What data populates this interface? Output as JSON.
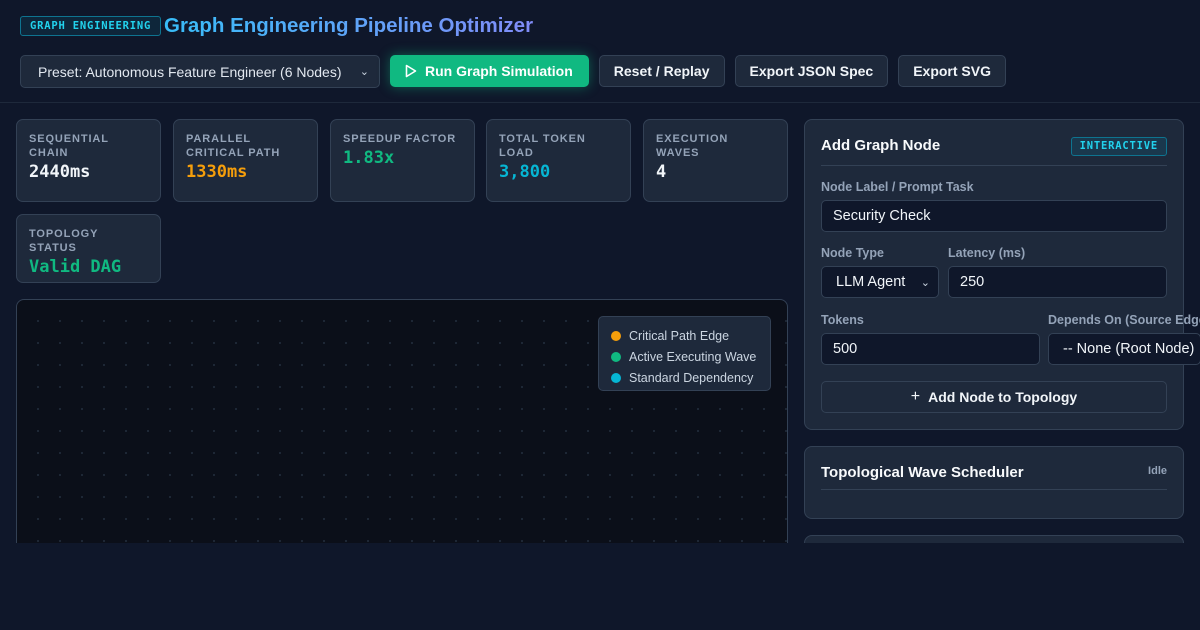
{
  "header": {
    "badge": "GRAPH ENGINEERING",
    "title": "Graph Engineering Pipeline Optimizer"
  },
  "toolbar": {
    "preset_value": "Preset: Autonomous Feature Engineer (6 Nodes)",
    "run_label": "Run Graph Simulation",
    "reset_label": "Reset / Replay",
    "export_json_label": "Export JSON Spec",
    "export_svg_label": "Export SVG"
  },
  "stats": [
    {
      "label": "SEQUENTIAL CHAIN",
      "value": "2440ms",
      "color": "#f1f5f9"
    },
    {
      "label": "PARALLEL CRITICAL PATH",
      "value": "1330ms",
      "color": "#f59e0b"
    },
    {
      "label": "SPEEDUP FACTOR",
      "value": "1.83x",
      "color": "#10b981"
    },
    {
      "label": "TOTAL TOKEN LOAD",
      "value": "3,800",
      "color": "#06b6d4"
    },
    {
      "label": "EXECUTION WAVES",
      "value": "4",
      "color": "#f1f5f9"
    },
    {
      "label": "TOPOLOGY STATUS",
      "value": "Valid DAG",
      "color": "#10b981"
    }
  ],
  "legend": [
    {
      "label": "Critical Path Edge",
      "color": "#f59e0b"
    },
    {
      "label": "Active Executing Wave",
      "color": "#10b981"
    },
    {
      "label": "Standard Dependency",
      "color": "#06b6d4"
    }
  ],
  "add_node": {
    "title": "Add Graph Node",
    "tag": "INTERACTIVE",
    "label_field": {
      "label": "Node Label / Prompt Task",
      "value": "Security Check"
    },
    "type_field": {
      "label": "Node Type",
      "value": "LLM Agent"
    },
    "latency_field": {
      "label": "Latency (ms)",
      "value": "250"
    },
    "tokens_field": {
      "label": "Tokens",
      "value": "500"
    },
    "depends_field": {
      "label": "Depends On (Source Edge",
      "value": "-- None (Root Node)"
    },
    "add_button": "Add Node to Topology"
  },
  "scheduler": {
    "title": "Topological Wave Scheduler",
    "status": "Idle"
  }
}
